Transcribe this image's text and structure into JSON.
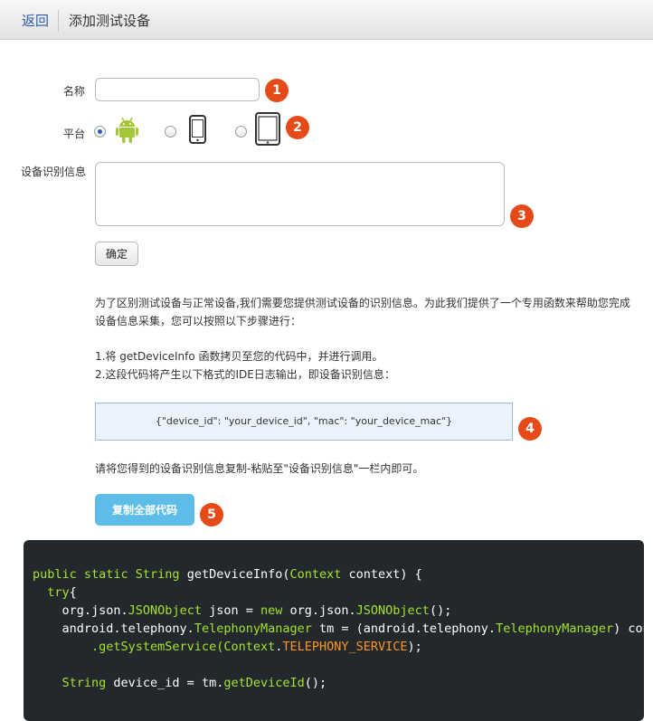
{
  "header": {
    "back_label": "返回",
    "title": "添加测试设备"
  },
  "form": {
    "name_label": "名称",
    "name_value": "",
    "platform_label": "平台",
    "platform_options": [
      {
        "name": "android",
        "icon": "android-icon",
        "selected": true
      },
      {
        "name": "phone",
        "icon": "phone-icon",
        "selected": false
      },
      {
        "name": "tablet",
        "icon": "tablet-icon",
        "selected": false
      }
    ],
    "device_info_label": "设备识别信息",
    "device_info_value": "",
    "confirm_label": "确定"
  },
  "badges": [
    "1",
    "2",
    "3",
    "4",
    "5"
  ],
  "instructions": {
    "intro_line1": "为了区别测试设备与正常设备,我们需要您提供测试设备的识别信息。为此我们提供了一个专用函数来帮助您完成",
    "intro_line2": "设备信息采集，您可以按照以下步骤进行：",
    "step1": "1.将 getDeviceInfo 函数拷贝至您的代码中，并进行调用。",
    "step2": "2.这段代码将产生以下格式的IDE日志输出，即设备识别信息：",
    "format_example": "{\"device_id\": \"your_device_id\", \"mac\": \"your_device_mac\"}",
    "paste_hint": "请将您得到的设备识别信息复制-粘贴至\"设备识别信息\"一栏内即可。"
  },
  "copy_button_label": "复制全部代码",
  "code": {
    "l1_a": "public static ",
    "l1_b": "String",
    "l1_c": " getDeviceInfo(",
    "l1_d": "Context",
    "l1_e": " context) {",
    "l2_a": "  try",
    "l2_b": "{",
    "l3_a": "    org.json.",
    "l3_b": "JSONObject",
    "l3_c": " json = ",
    "l3_d": "new",
    "l3_e": " org.json.",
    "l3_f": "JSONObject",
    "l3_g": "();",
    "l4_a": "    android.telephony.",
    "l4_b": "TelephonyManager",
    "l4_c": " tm = (android.telephony.",
    "l4_d": "TelephonyManager",
    "l4_e": ") context",
    "l5_a": "        .getSystemService(",
    "l5_b": "Context",
    "l5_c": ".",
    "l5_d": "TELEPHONY_SERVICE",
    "l5_e": ");",
    "l6_a": "    String",
    "l6_b": " device_id = tm.",
    "l6_c": "getDeviceId",
    "l6_d": "();"
  },
  "colors": {
    "badge": "#e64a19",
    "copy_button": "#5bbde8",
    "code_bg": "#23282c",
    "keyword": "#a6e22e",
    "constant": "#fd971f",
    "android_green": "#a4c639"
  }
}
